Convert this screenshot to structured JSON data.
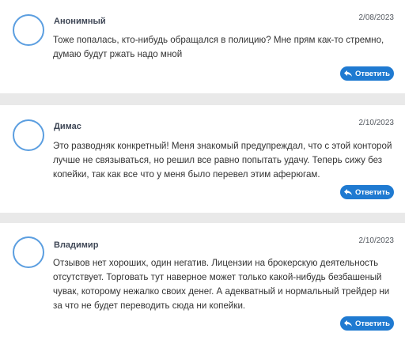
{
  "comments": [
    {
      "author": "Анонимный",
      "date": "2/08/2023",
      "text": "Тоже попалась, кто-нибудь обращался в полицию? Мне прям как-то стремно, думаю будут ржать надо мной",
      "reply_label": "Ответить"
    },
    {
      "author": "Димас",
      "date": "2/10/2023",
      "text": "Это разводняк конкретный! Меня знакомый предупреждал, что с этой конторой лучше не связываться, но решил все равно попытать удачу. Теперь сижу без копейки, так как все что у меня было перевел этим аферюгам.",
      "reply_label": "Ответить"
    },
    {
      "author": "Владимир",
      "date": "2/10/2023",
      "text": "Отзывов нет хороших, один негатив. Лицензии на брокерскую деятельность отсутствует. Торговать тут наверное может только какой-нибудь безбашеный чувак, которому нежалко своих денег. А адекватный и нормальный трейдер ни за что не будет переводить сюда ни копейки.",
      "reply_label": "Ответить"
    }
  ],
  "icons": {
    "reply": "reply-arrow-icon"
  },
  "colors": {
    "accent": "#1f7ad1",
    "avatar_border": "#5b9ee0",
    "background": "#e9e9e9"
  }
}
